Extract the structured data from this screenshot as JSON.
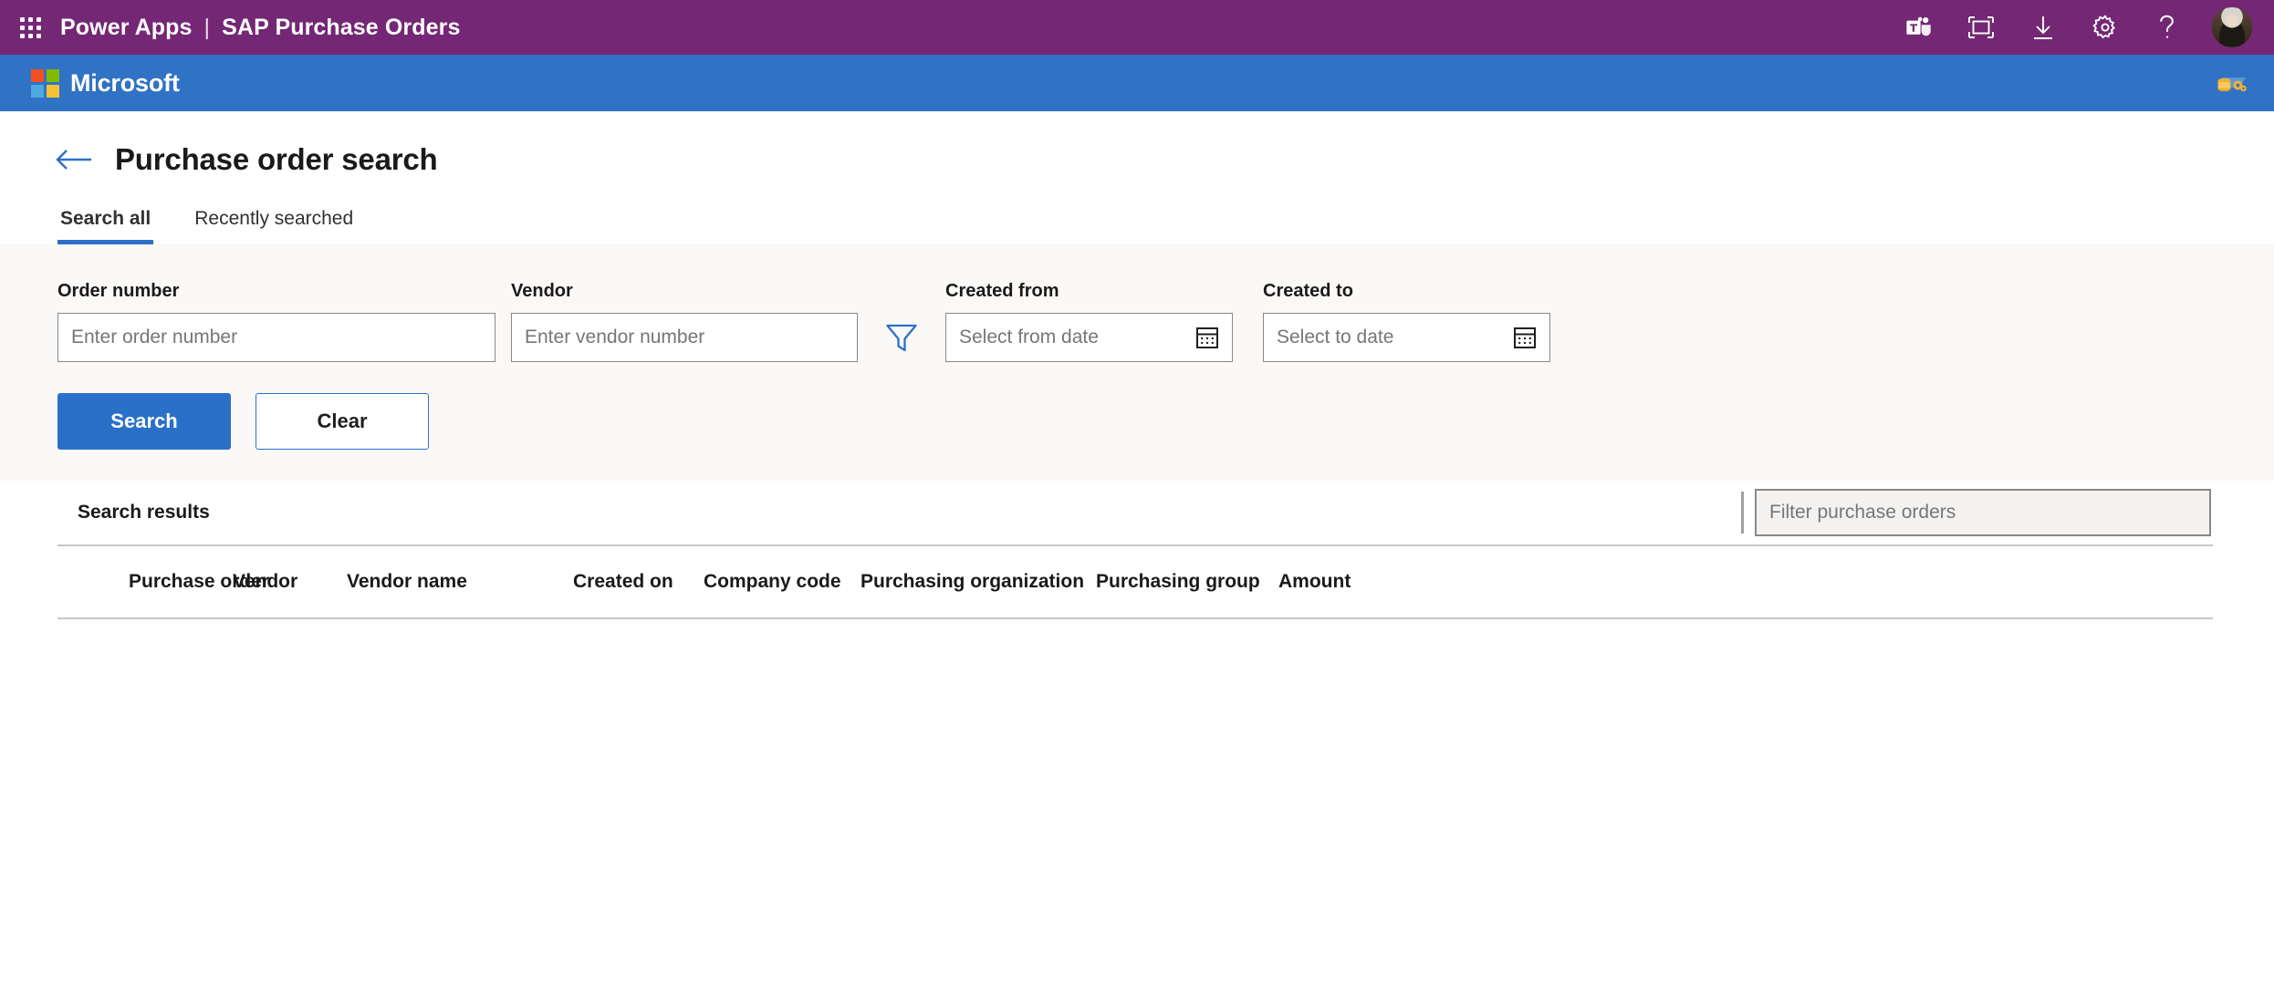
{
  "suite": {
    "waffle_label": "app-launcher",
    "product": "Power Apps",
    "separator": "|",
    "app_name": "SAP Purchase Orders",
    "icons": [
      {
        "name": "teams-icon",
        "label": "Teams"
      },
      {
        "name": "fit-to-screen-icon",
        "label": "Fit to screen"
      },
      {
        "name": "download-icon",
        "label": "Download"
      },
      {
        "name": "settings-gear-icon",
        "label": "Settings"
      },
      {
        "name": "help-icon",
        "label": "?"
      }
    ],
    "avatar_label": "User account"
  },
  "brand": {
    "name": "Microsoft",
    "logo_colors": [
      "#f25022",
      "#7fba00",
      "#4fa8e0",
      "#f5c236"
    ],
    "right_icon": "sap-database-icon"
  },
  "page": {
    "back_label": "Back",
    "title": "Purchase order search"
  },
  "tabs": [
    {
      "label": "Search all",
      "active": true
    },
    {
      "label": "Recently searched",
      "active": false
    }
  ],
  "search_form": {
    "order_number": {
      "label": "Order number",
      "placeholder": "Enter order number",
      "value": ""
    },
    "vendor": {
      "label": "Vendor",
      "placeholder": "Enter vendor number",
      "value": ""
    },
    "filter_icon": "filter-funnel-icon",
    "created_from": {
      "label": "Created from",
      "placeholder": "Select from date",
      "value": ""
    },
    "created_to": {
      "label": "Created to",
      "placeholder": "Select to date",
      "value": ""
    },
    "search_button": "Search",
    "clear_button": "Clear"
  },
  "results": {
    "title": "Search results",
    "filter": {
      "placeholder": "Filter purchase orders",
      "value": ""
    },
    "columns": [
      "Purchase order",
      "Vendor",
      "Vendor name",
      "Created on",
      "Company code",
      "Purchasing organization",
      "Purchasing group",
      "Amount"
    ],
    "rows": []
  },
  "colors": {
    "suite_bar": "#742774",
    "brand_bar": "#3072c4",
    "accent_blue": "#2b70c8",
    "panel_bg": "#faf9f8",
    "border": "#c8c6c4"
  }
}
